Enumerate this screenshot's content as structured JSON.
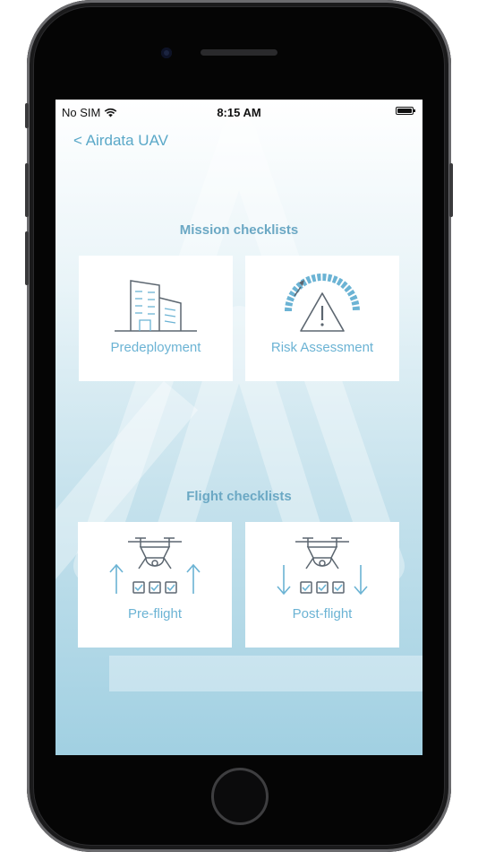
{
  "status_bar": {
    "carrier": "No SIM",
    "time": "8:15 AM"
  },
  "nav": {
    "back_label": "< Airdata UAV"
  },
  "mission": {
    "title": "Mission checklists",
    "items": [
      {
        "label": "Predeployment",
        "icon": "buildings-icon"
      },
      {
        "label": "Risk Assessment",
        "icon": "risk-gauge-warning-icon"
      }
    ]
  },
  "flight": {
    "title": "Flight checklists",
    "items": [
      {
        "label": "Pre-flight",
        "icon": "drone-up-arrows-icon"
      },
      {
        "label": "Post-flight",
        "icon": "drone-down-arrows-icon"
      }
    ]
  },
  "colors": {
    "accent": "#6bb3d4",
    "icon_gray": "#5c6670",
    "section_title": "#6ba8c4"
  }
}
